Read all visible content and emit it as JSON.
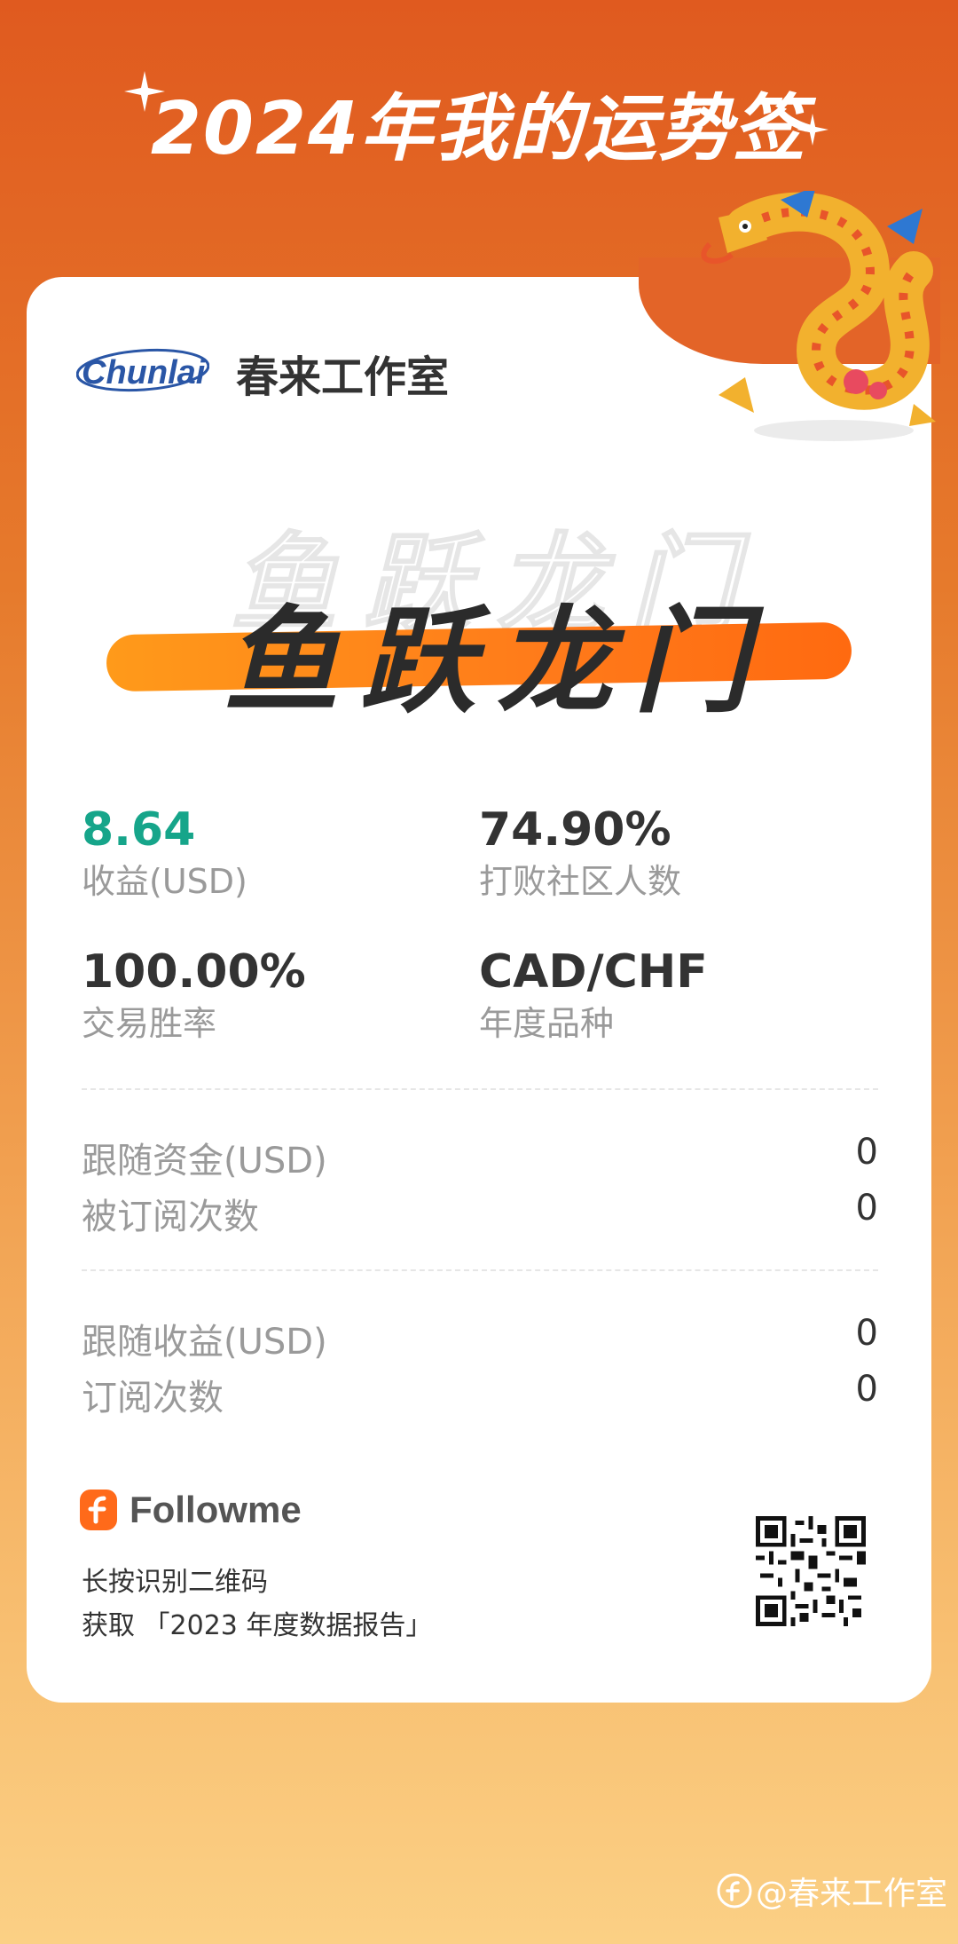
{
  "header": {
    "title": "2024年我的运势签"
  },
  "card": {
    "brand_logo_text": "Chunlai",
    "brand_name": "春来工作室",
    "headline": "鱼跃龙门"
  },
  "stats": [
    {
      "value": "8.64",
      "label": "收益(USD)",
      "accent": "#16A58A"
    },
    {
      "value": "74.90%",
      "label": "打败社区人数"
    },
    {
      "value": "100.00%",
      "label": "交易胜率"
    },
    {
      "value": "CAD/CHF",
      "label": "年度品种"
    }
  ],
  "rows": [
    {
      "label": "跟随资金(USD)",
      "value": "0"
    },
    {
      "label": "被订阅次数",
      "value": "0"
    },
    {
      "label": "跟随收益(USD)",
      "value": "0"
    },
    {
      "label": "订阅次数",
      "value": "0"
    }
  ],
  "footer": {
    "followme_name": "Followme",
    "line1": "长按识别二维码",
    "line2": "获取 「2023 年度数据报告」"
  },
  "watermark": "@春来工作室",
  "colors": {
    "bg_top": "#E05A1F",
    "bg_bottom": "#FBD085",
    "accent_orange": "#FF7A1A",
    "green": "#16A58A"
  },
  "icons": [
    "sparkle-icon",
    "dragon-illustration",
    "followme-logo-icon",
    "qr-code",
    "weibo-icon"
  ]
}
